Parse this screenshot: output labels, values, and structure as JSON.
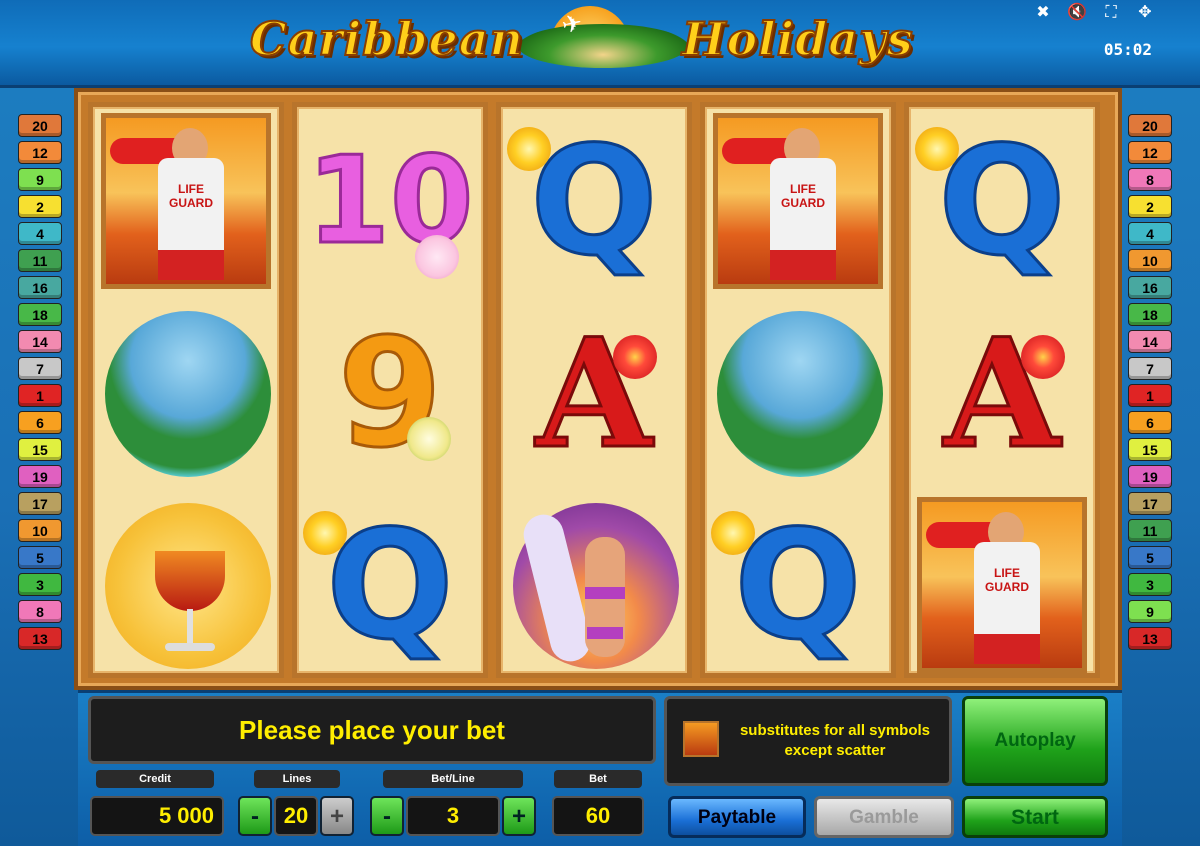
{
  "title": {
    "word1": "Caribbean",
    "word2": "Holidays"
  },
  "system": {
    "clock": "05:02",
    "icons": [
      "sound-off-icon",
      "mute-icon",
      "fullscreen-icon",
      "expand-icon"
    ]
  },
  "paylines_left": [
    {
      "n": "20",
      "color": "#e0783a"
    },
    {
      "n": "12",
      "color": "#f28a3a"
    },
    {
      "n": "9",
      "color": "#7ee050"
    },
    {
      "n": "2",
      "color": "#f7e030"
    },
    {
      "n": "4",
      "color": "#3fb8c8"
    },
    {
      "n": "11",
      "color": "#3fa050"
    },
    {
      "n": "16",
      "color": "#48a8a0"
    },
    {
      "n": "18",
      "color": "#48b848"
    },
    {
      "n": "14",
      "color": "#f28ab0"
    },
    {
      "n": "7",
      "color": "#c8c8c8"
    },
    {
      "n": "1",
      "color": "#e02424"
    },
    {
      "n": "6",
      "color": "#f7a020"
    },
    {
      "n": "15",
      "color": "#e0f040"
    },
    {
      "n": "19",
      "color": "#e060c0"
    },
    {
      "n": "17",
      "color": "#b8a060"
    },
    {
      "n": "10",
      "color": "#f09830"
    },
    {
      "n": "5",
      "color": "#3878c8"
    },
    {
      "n": "3",
      "color": "#40b840"
    },
    {
      "n": "8",
      "color": "#f078b8"
    },
    {
      "n": "13",
      "color": "#d82828"
    }
  ],
  "paylines_right": [
    {
      "n": "20",
      "color": "#e0783a"
    },
    {
      "n": "12",
      "color": "#f28a3a"
    },
    {
      "n": "8",
      "color": "#f078b8"
    },
    {
      "n": "2",
      "color": "#f7e030"
    },
    {
      "n": "4",
      "color": "#3fb8c8"
    },
    {
      "n": "10",
      "color": "#f09830"
    },
    {
      "n": "16",
      "color": "#48a8a0"
    },
    {
      "n": "18",
      "color": "#48b848"
    },
    {
      "n": "14",
      "color": "#f28ab0"
    },
    {
      "n": "7",
      "color": "#c8c8c8"
    },
    {
      "n": "1",
      "color": "#e02424"
    },
    {
      "n": "6",
      "color": "#f7a020"
    },
    {
      "n": "15",
      "color": "#e0f040"
    },
    {
      "n": "19",
      "color": "#e060c0"
    },
    {
      "n": "17",
      "color": "#b8a060"
    },
    {
      "n": "11",
      "color": "#3fa050"
    },
    {
      "n": "5",
      "color": "#3878c8"
    },
    {
      "n": "3",
      "color": "#40b840"
    },
    {
      "n": "9",
      "color": "#7ee050"
    },
    {
      "n": "13",
      "color": "#d82828"
    }
  ],
  "reels": [
    [
      "lifeguard",
      "beach",
      "cocktail"
    ],
    [
      "ten",
      "nine",
      "queen"
    ],
    [
      "queen",
      "ace",
      "surfer"
    ],
    [
      "lifeguard",
      "beach",
      "queen"
    ],
    [
      "queen",
      "ace",
      "lifeguard"
    ]
  ],
  "symbol_text": {
    "ten": "10",
    "nine": "9",
    "queen": "Q",
    "ace": "A",
    "lifeguard": "LIFE GUARD"
  },
  "message": "Please place your bet",
  "info": {
    "text": "substitutes for all symbols except scatter"
  },
  "credit": {
    "label": "Credit",
    "value": "5 000"
  },
  "lines": {
    "label": "Lines",
    "value": "20",
    "minus": "-",
    "plus": "+"
  },
  "bet_line": {
    "label": "Bet/Line",
    "value": "3",
    "minus": "-",
    "plus": "+"
  },
  "bet": {
    "label": "Bet",
    "value": "60"
  },
  "buttons": {
    "paytable": "Paytable",
    "gamble": "Gamble",
    "autoplay": "Autoplay",
    "start": "Start"
  }
}
